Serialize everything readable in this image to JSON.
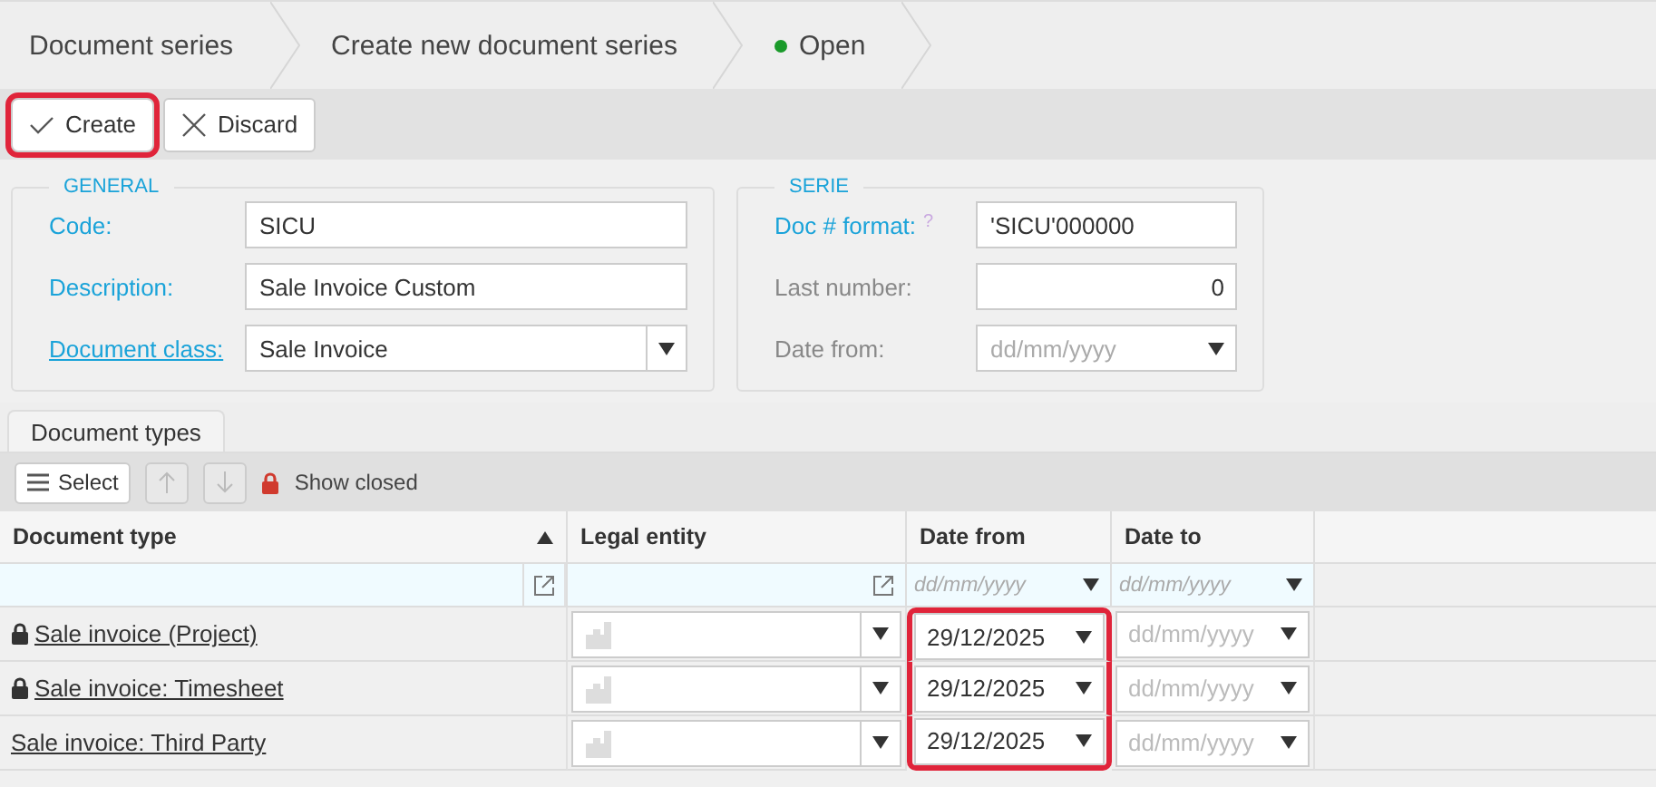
{
  "breadcrumbs": [
    {
      "label": "Document series",
      "kind": "text"
    },
    {
      "label": "Create new document series",
      "kind": "text"
    },
    {
      "label": "Open",
      "kind": "status",
      "color": "#1a9a2a"
    }
  ],
  "toolbar": [
    {
      "label": "Create",
      "kind": "check",
      "highlighted": true
    },
    {
      "label": "Discard",
      "kind": "close",
      "highlighted": false
    }
  ],
  "general": {
    "title": "GENERAL",
    "fields": [
      {
        "label": "Code:",
        "value": "SICU",
        "kind": "text",
        "link": false
      },
      {
        "label": "Description:",
        "value": "Sale Invoice Custom",
        "kind": "text",
        "link": false
      },
      {
        "label": "Document class:",
        "value": "Sale Invoice",
        "kind": "select",
        "link": true
      }
    ]
  },
  "serie": {
    "title": "SERIE",
    "fields": [
      {
        "label": "Doc # format:",
        "hint": "?",
        "value": "'SICU'000000",
        "kind": "text",
        "required": true
      },
      {
        "label": "Last number:",
        "value": "0",
        "kind": "number",
        "required": false
      },
      {
        "label": "Date from:",
        "placeholder": "dd/mm/yyyy",
        "kind": "date",
        "required": false
      }
    ]
  },
  "tabs": [
    {
      "label": "Document types",
      "selected": true
    }
  ],
  "grid_toolbar": {
    "select": "Select",
    "show_closed": "Show closed"
  },
  "table": {
    "columns": [
      {
        "label": "Document type",
        "sorted": true
      },
      {
        "label": "Legal entity",
        "sorted": false
      },
      {
        "label": "Date from",
        "sorted": false
      },
      {
        "label": "Date to",
        "sorted": false
      }
    ],
    "filter": {
      "date_from": "dd/mm/yyyy",
      "date_to": "dd/mm/yyyy"
    },
    "rows": [
      {
        "name": "Sale invoice (Project)",
        "locked": true,
        "date_from": "29/12/2025",
        "date_from_highlighted": true,
        "date_to_placeholder": "dd/mm/yyyy"
      },
      {
        "name": "Sale invoice: Timesheet",
        "locked": true,
        "date_from": "29/12/2025",
        "date_from_highlighted": true,
        "date_to_placeholder": "dd/mm/yyyy"
      },
      {
        "name": "Sale invoice: Third Party",
        "locked": false,
        "date_from": "29/12/2025",
        "date_from_highlighted": true,
        "date_to_placeholder": "dd/mm/yyyy"
      }
    ]
  }
}
